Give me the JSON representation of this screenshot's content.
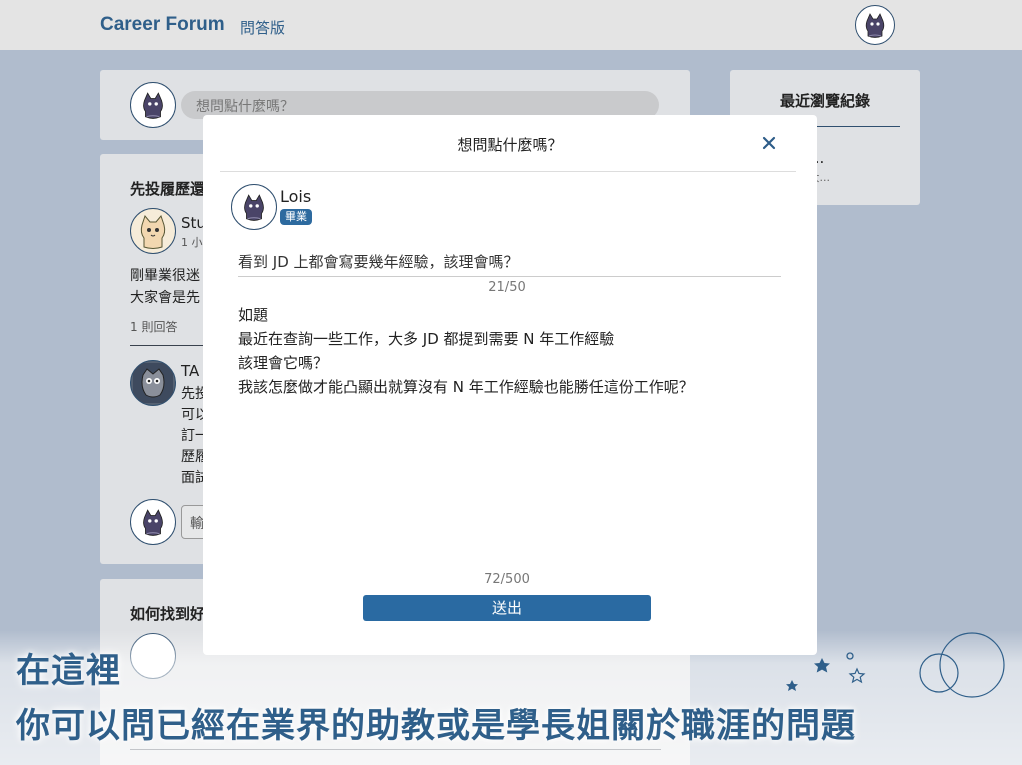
{
  "nav": {
    "brand": "Career Forum",
    "link": "問答版"
  },
  "ask_box": {
    "placeholder": "想問點什麼嗎？"
  },
  "post": {
    "title": "先投履歷還",
    "author_name": "Stu",
    "time": "1 小",
    "body_lines": [
      "剛畢業很迷",
      " 大家會是先"
    ],
    "answer_count": "1 則回答",
    "reply": {
      "author_name": "TA",
      "lines": [
        "先投",
        "可以",
        "訂一",
        "歷履",
        "面試"
      ]
    },
    "reply_input_placeholder": "輸"
  },
  "post2": {
    "title": "如何找到好"
  },
  "sidebar": {
    "title": "最近瀏覽紀錄",
    "item_title": "投履歷還...",
    "item_snippet": "畢業很迷茫 大..."
  },
  "modal": {
    "title": "想問點什麼嗎？",
    "user_name": "Lois",
    "user_badge": "畢業",
    "question_title": "看到 JD 上都會寫要幾年經驗，該理會嗎？",
    "title_count": "21/50",
    "body_lines": [
      "如題",
      "最近在查詢一些工作，大多 JD 都提到需要 N 年工作經驗",
      "該理會它嗎？",
      "我該怎麼做才能凸顯出就算沒有 N 年工作經驗也能勝任這份工作呢？"
    ],
    "body_count": "72/500",
    "submit_label": "送出"
  },
  "banner": {
    "line1": "在這裡",
    "line2": "你可以問已經在業界的助教或是學長姐關於職涯的問題"
  },
  "colors": {
    "accent": "#2f5f8a",
    "button": "#2a6aa2",
    "page_bg": "#b0bccd"
  }
}
